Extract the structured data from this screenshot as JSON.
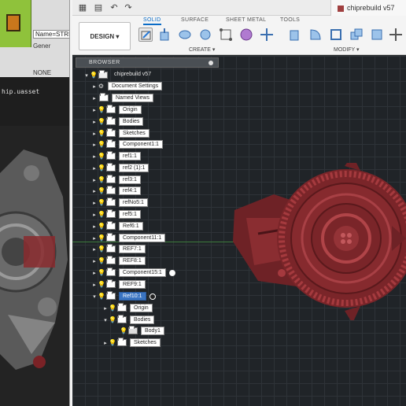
{
  "left_app": {
    "field_text": "Name=STRI",
    "line1": "Gener",
    "line2": "NONE",
    "title": "hip.uasset"
  },
  "qat": {
    "grid_icon": "grid-icon",
    "file_icon": "file-icon",
    "undo_icon": "undo-icon",
    "redo_icon": "redo-icon",
    "doc_title": "chiprebuild v57"
  },
  "toolbar": {
    "design_label": "DESIGN ▾",
    "tabs": [
      "SOLID",
      "SURFACE",
      "SHEET METAL",
      "TOOLS"
    ],
    "create_label": "CREATE ▾",
    "modify_label": "MODIFY ▾"
  },
  "browser": {
    "title": "BROWSER",
    "root": "chiprebuild v57",
    "items": [
      {
        "label": "Document Settings"
      },
      {
        "label": "Named Views"
      },
      {
        "label": "Origin"
      },
      {
        "label": "Bodies"
      },
      {
        "label": "Sketches"
      },
      {
        "label": "Component1:1"
      },
      {
        "label": "ref1:1"
      },
      {
        "label": "ref2 (1):1"
      },
      {
        "label": "ref3:1"
      },
      {
        "label": "ref4:1"
      },
      {
        "label": "refNo5:1"
      },
      {
        "label": "ref5:1"
      },
      {
        "label": "Ref6:1"
      },
      {
        "label": "Component11:1"
      },
      {
        "label": "REF7:1"
      },
      {
        "label": "REF8:1"
      },
      {
        "label": "Component15:1"
      },
      {
        "label": "REF9:1"
      },
      {
        "label": "Ref10:1"
      },
      {
        "label": "Origin"
      },
      {
        "label": "Bodies"
      },
      {
        "label": "Body1"
      },
      {
        "label": "Sketches"
      }
    ]
  },
  "colors": {
    "accent": "#0a6cc7",
    "model_red": "#8a2a2e",
    "selection": "#3a74c2"
  }
}
